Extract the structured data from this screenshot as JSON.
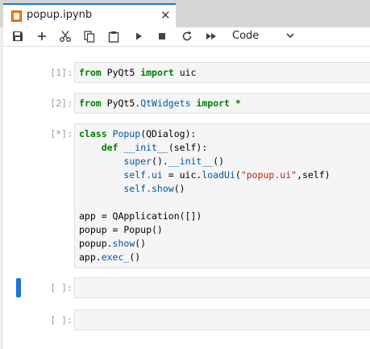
{
  "tab": {
    "title": "popup.ipynb",
    "close_glyph": "✕"
  },
  "toolbar": {
    "buttons": [
      "save-icon",
      "add-icon",
      "cut-icon",
      "copy-icon",
      "paste-icon",
      "run-icon",
      "stop-icon",
      "restart-icon",
      "fast-forward-icon"
    ],
    "cell_type": "Code"
  },
  "cells": [
    {
      "prompt": "[1]:",
      "lines": [
        "from PyQt5 import uic"
      ]
    },
    {
      "prompt": "[2]:",
      "lines": [
        "from PyQt5.QtWidgets import *"
      ]
    },
    {
      "prompt": "[*]:",
      "lines": [
        "class Popup(QDialog):",
        "    def __init__(self):",
        "        super().__init__()",
        "        self.ui = uic.loadUi(\"popup.ui\",self)",
        "        self.show()",
        "",
        "app = QApplication([])",
        "popup = Popup()",
        "popup.show()",
        "app.exec_()"
      ]
    },
    {
      "prompt": "[ ]:",
      "lines": []
    },
    {
      "prompt": "[ ]:",
      "lines": []
    }
  ],
  "colors": {
    "accent": "#1976d2",
    "keyword": "#008000",
    "string": "#ba2121",
    "name": "#0055aa"
  }
}
